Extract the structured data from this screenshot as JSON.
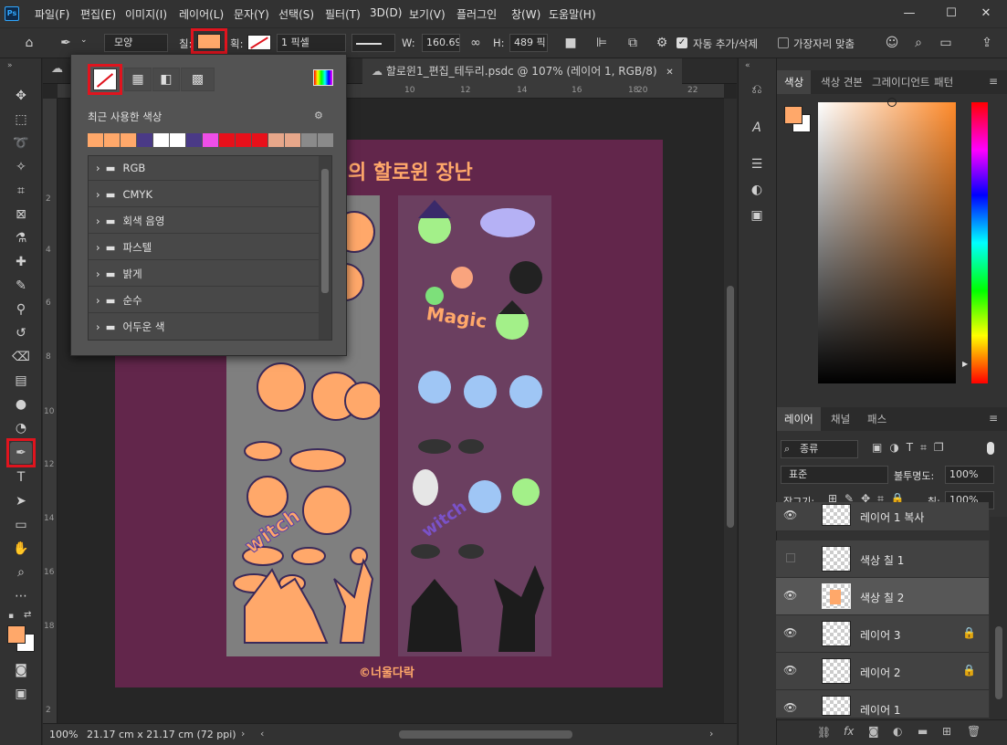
{
  "app": {
    "logo": "Ps"
  },
  "menubar": {
    "items": [
      "파일(F)",
      "편집(E)",
      "이미지(I)",
      "레이어(L)",
      "문자(Y)",
      "선택(S)",
      "필터(T)",
      "3D(D)",
      "보기(V)",
      "플러그인",
      "창(W)",
      "도움말(H)"
    ]
  },
  "window_controls": {
    "minimize": "—",
    "maximize": "☐",
    "close": "✕"
  },
  "options": {
    "home_icon": "home-icon",
    "tool_icon": "pen-tool-icon",
    "mode_value": "모양",
    "fill_label": "칠:",
    "fill_color": "#ffa86a",
    "stroke_label": "획:",
    "stroke_width": "1 픽셀",
    "w_label": "W:",
    "w_value": "160.69",
    "link_icon": "link-icon",
    "h_label": "H:",
    "h_value": "489 픽",
    "auto_add_delete": "자동 추가/삭제",
    "align_edges": "가장자리 맞춤"
  },
  "tabs": [
    {
      "label": "할로윈1_편집_테두리.psdc @ 107% (레이어 1, RGB/8)",
      "close": "✕"
    }
  ],
  "ruler": {
    "h_ticks": [
      "10",
      "12",
      "14",
      "16",
      "18",
      "20",
      "22"
    ],
    "v_ticks": [
      "2",
      "4",
      "6",
      "8",
      "10",
      "12",
      "14",
      "16",
      "18",
      "2"
    ]
  },
  "document": {
    "title_text": "의 할로윈 장난",
    "left_text": "witch",
    "right_text": "Magic",
    "right_text2": "witch",
    "credit": "©너울다락",
    "bg_color": "#62264b",
    "accent": "#ffa86a"
  },
  "status": {
    "zoom": "100%",
    "doc_size": "21.17 cm x 21.17 cm (72 ppi)"
  },
  "popup": {
    "recent_label": "최근 사용한 색상",
    "swatches": [
      "#ffa86a",
      "#ffa86a",
      "#ffa86a",
      "#4a3a86",
      "#ffffff",
      "#ffffff",
      "#4a3a86",
      "#ee4ee8",
      "#e8101a",
      "#e8101a",
      "#e8101a",
      "#e7a78a",
      "#e7a78a",
      "#8a8a8a",
      "#8a8a8a"
    ],
    "folders": [
      "RGB",
      "CMYK",
      "회색 음영",
      "파스텔",
      "밝게",
      "순수",
      "어두운 색"
    ]
  },
  "color_panel": {
    "tabs": [
      "색상",
      "색상 견본",
      "그레이디언트",
      "패턴"
    ],
    "fg": "#ffa86a",
    "bg": "#ffffff"
  },
  "layers_panel": {
    "tabs": [
      "레이어",
      "채널",
      "패스"
    ],
    "filter": "종류",
    "blend": "표준",
    "opacity_label": "불투명도:",
    "opacity": "100%",
    "lock_label": "잠그기:",
    "fill_label": "칠:",
    "fill": "100%",
    "layers": [
      {
        "name": "레이어 1 복사",
        "visible": true,
        "locked": false,
        "selected": false
      },
      {
        "name": "색상 칠 1",
        "visible": false,
        "locked": false,
        "selected": false
      },
      {
        "name": "색상 칠 2",
        "visible": true,
        "locked": false,
        "selected": true
      },
      {
        "name": "레이어 3",
        "visible": true,
        "locked": true,
        "selected": false
      },
      {
        "name": "레이어 2",
        "visible": true,
        "locked": true,
        "selected": false
      },
      {
        "name": "레이어 1",
        "visible": true,
        "locked": false,
        "selected": false
      }
    ],
    "footer_icons": [
      "link-icon",
      "fx-icon",
      "mask-icon",
      "adjustment-icon",
      "group-icon",
      "new-layer-icon",
      "trash-icon"
    ]
  }
}
